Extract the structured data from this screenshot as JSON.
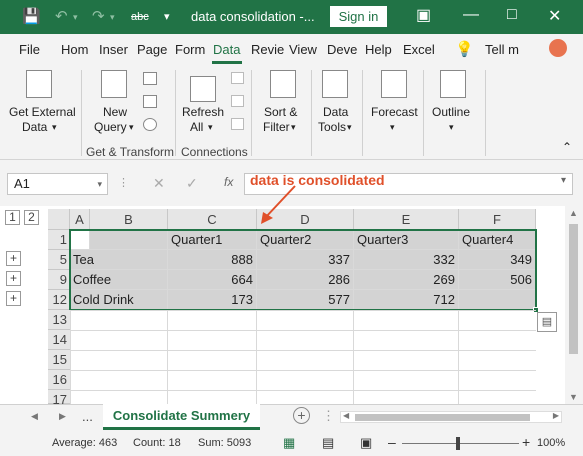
{
  "titlebar": {
    "title": "data consolidation  -...",
    "signin": "Sign in",
    "undo_redo_hint": "abc"
  },
  "tabs": [
    "File",
    "Hom",
    "Inser",
    "Page",
    "Form",
    "Data",
    "Revie",
    "View",
    "Deve",
    "Help",
    "Excel",
    "Tell m"
  ],
  "ribbon": {
    "get_external_1": "Get External",
    "get_external_2": "Data",
    "new_query_1": "New",
    "new_query_2": "Query",
    "refresh_1": "Refresh",
    "refresh_2": "All",
    "sort_1": "Sort &",
    "sort_2": "Filter",
    "data_tools_1": "Data",
    "data_tools_2": "Tools",
    "forecast_1": "Forecast",
    "outline_1": "Outline",
    "group_get_transform": "Get & Transform",
    "group_connections": "Connections"
  },
  "formula_bar": {
    "name_box": "A1",
    "fx": "fx",
    "annotation": "data is consolidated"
  },
  "grid": {
    "outline_levels": [
      "1",
      "2"
    ],
    "columns": [
      "A",
      "B",
      "C",
      "D",
      "E",
      "F"
    ],
    "rows": [
      {
        "num": "1",
        "b": "",
        "c": "Quarter1",
        "d": "Quarter2",
        "e": "Quarter3",
        "f": "Quarter4"
      },
      {
        "num": "5",
        "b": "Tea",
        "c": "888",
        "d": "337",
        "e": "332",
        "f": "349"
      },
      {
        "num": "9",
        "b": "Coffee",
        "c": "664",
        "d": "286",
        "e": "269",
        "f": "506"
      },
      {
        "num": "12",
        "b": "Cold Drink",
        "c": "173",
        "d": "577",
        "e": "712",
        "f": ""
      }
    ],
    "empty_rows": [
      "13",
      "14",
      "15",
      "16",
      "17"
    ]
  },
  "sheet": {
    "tab": "Consolidate Summery",
    "more": "..."
  },
  "status": {
    "average": "Average: 463",
    "count": "Count: 18",
    "sum": "Sum: 5093",
    "zoom": "100%"
  },
  "colors": {
    "brand": "#217346",
    "annotation": "#e0502a"
  }
}
